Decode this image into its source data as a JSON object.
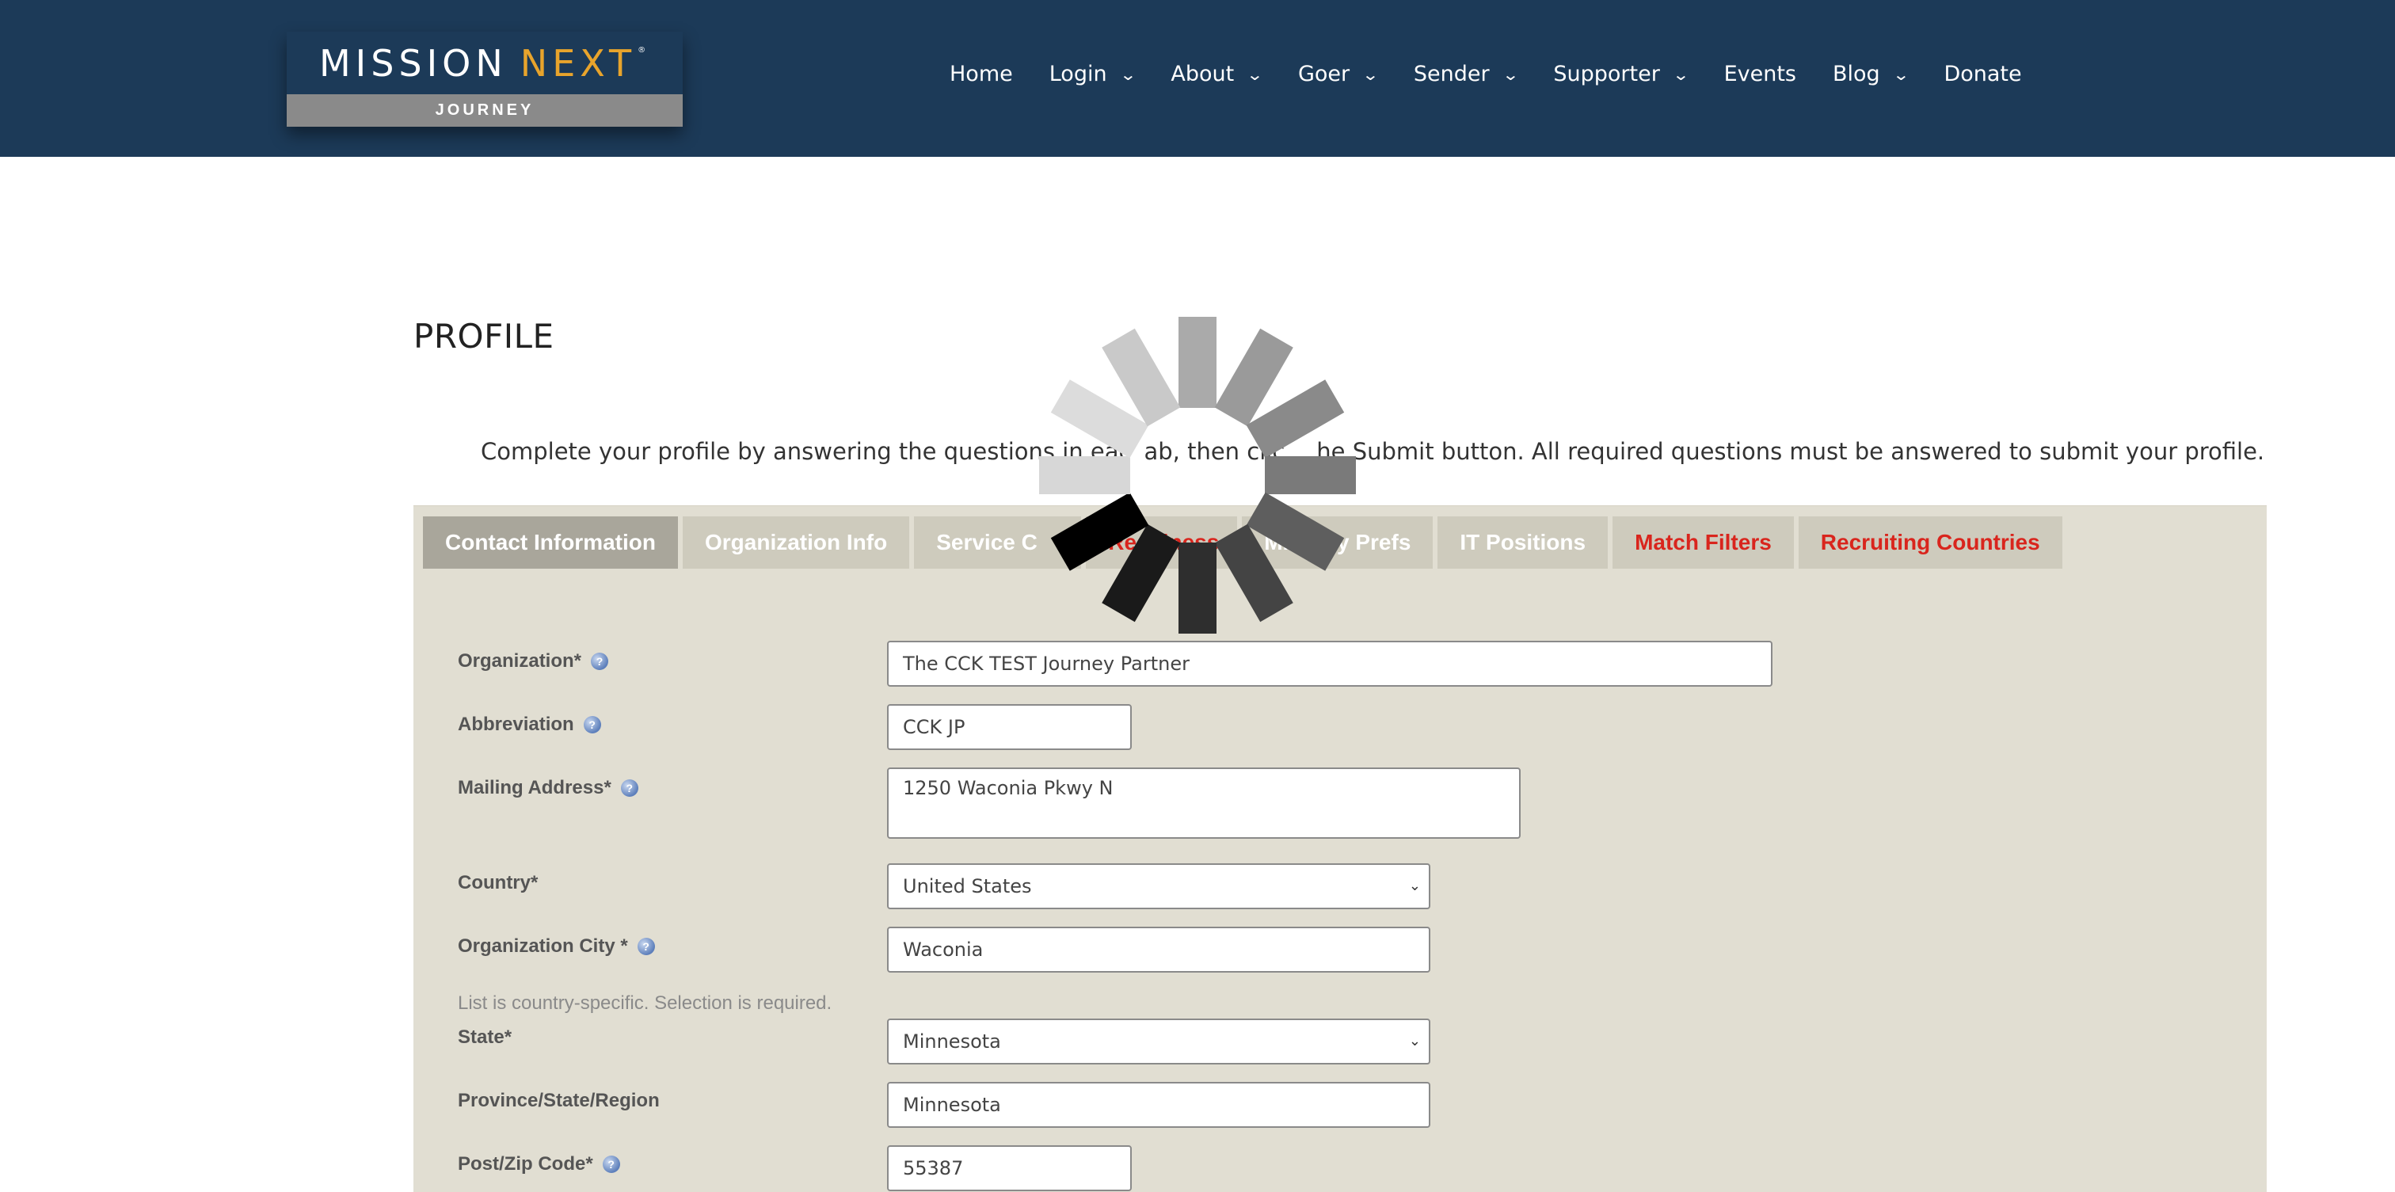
{
  "header": {
    "logo": {
      "word1": "MISSION",
      "word2": "NEXT",
      "tm": "®",
      "subtitle": "JOURNEY"
    },
    "nav": [
      {
        "label": "Home",
        "has_dropdown": false
      },
      {
        "label": "Login",
        "has_dropdown": true
      },
      {
        "label": "About",
        "has_dropdown": true
      },
      {
        "label": "Goer",
        "has_dropdown": true
      },
      {
        "label": "Sender",
        "has_dropdown": true
      },
      {
        "label": "Supporter",
        "has_dropdown": true
      },
      {
        "label": "Events",
        "has_dropdown": false
      },
      {
        "label": "Blog",
        "has_dropdown": true
      },
      {
        "label": "Donate",
        "has_dropdown": false
      }
    ]
  },
  "page": {
    "title": "PROFILE",
    "intro_left": "Complete your profile by answering the questions in eac",
    "intro_mid": "ab, then clic",
    "intro_right": "he Submit button. All required questions must be answered to submit your profile."
  },
  "tabs": [
    {
      "label": "Contact Information",
      "active": true,
      "color": "#ffffff"
    },
    {
      "label": "Organization Info",
      "active": false,
      "color": "#ffffff"
    },
    {
      "label": "Service C",
      "active": false,
      "color": "#ffffff"
    },
    {
      "label": "Readiness",
      "active": false,
      "color": "#d9251d"
    },
    {
      "label": "Ministry Prefs",
      "active": false,
      "color": "#ffffff"
    },
    {
      "label": "IT Positions",
      "active": false,
      "color": "#ffffff"
    },
    {
      "label": "Match Filters",
      "active": false,
      "color": "#d9251d"
    },
    {
      "label": "Recruiting Countries",
      "active": false,
      "color": "#d9251d"
    }
  ],
  "form": {
    "organization": {
      "label": "Organization*",
      "value": "The CCK TEST Journey Partner"
    },
    "abbreviation": {
      "label": "Abbreviation",
      "value": "CCK JP"
    },
    "mailing_address": {
      "label": "Mailing Address*",
      "value": "1250 Waconia Pkwy N"
    },
    "country": {
      "label": "Country*",
      "value": "United States"
    },
    "city": {
      "label": "Organization City *",
      "value": "Waconia"
    },
    "state_note": "List is country-specific. Selection is required.",
    "state": {
      "label": "State*",
      "value": "Minnesota"
    },
    "province": {
      "label": "Province/State/Region",
      "value": "Minnesota"
    },
    "zip": {
      "label": "Post/Zip Code*",
      "value": "55387"
    }
  },
  "icons": {
    "help": "help-question-icon",
    "loading": "loading-spinner-icon",
    "dropdown": "chevron-down-icon"
  },
  "colors": {
    "header_bg": "#1c3a58",
    "accent": "#e8a42c",
    "panel_bg": "#e1ded2",
    "required_tab": "#d9251d"
  }
}
